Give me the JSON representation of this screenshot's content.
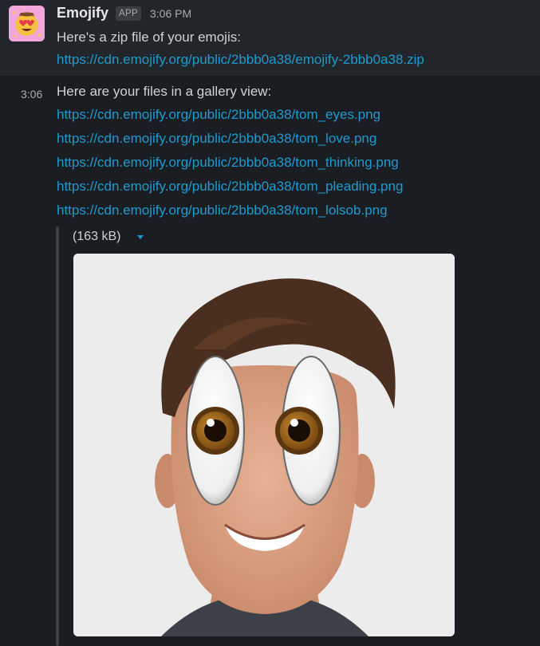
{
  "message1": {
    "sender": "Emojify",
    "badge": "APP",
    "time": "3:06 PM",
    "text": "Here's a zip file of your emojis:",
    "zip_link": "https://cdn.emojify.org/public/2bbb0a38/emojify-2bbb0a38.zip",
    "avatar_icon": "heart-eyes-emoji-icon"
  },
  "message2": {
    "time": "3:06",
    "text": "Here are your files in a gallery view:",
    "links": [
      "https://cdn.emojify.org/public/2bbb0a38/tom_eyes.png",
      "https://cdn.emojify.org/public/2bbb0a38/tom_love.png",
      "https://cdn.emojify.org/public/2bbb0a38/tom_thinking.png",
      "https://cdn.emojify.org/public/2bbb0a38/tom_pleading.png",
      "https://cdn.emojify.org/public/2bbb0a38/tom_lolsob.png"
    ],
    "attachment": {
      "size": "(163 kB)",
      "image_icon": "face-with-eyes-emoji-image"
    }
  },
  "colors": {
    "background": "#1a1d21",
    "link": "#1d9bd1",
    "text": "#d1d2d3",
    "muted": "#ababad"
  }
}
